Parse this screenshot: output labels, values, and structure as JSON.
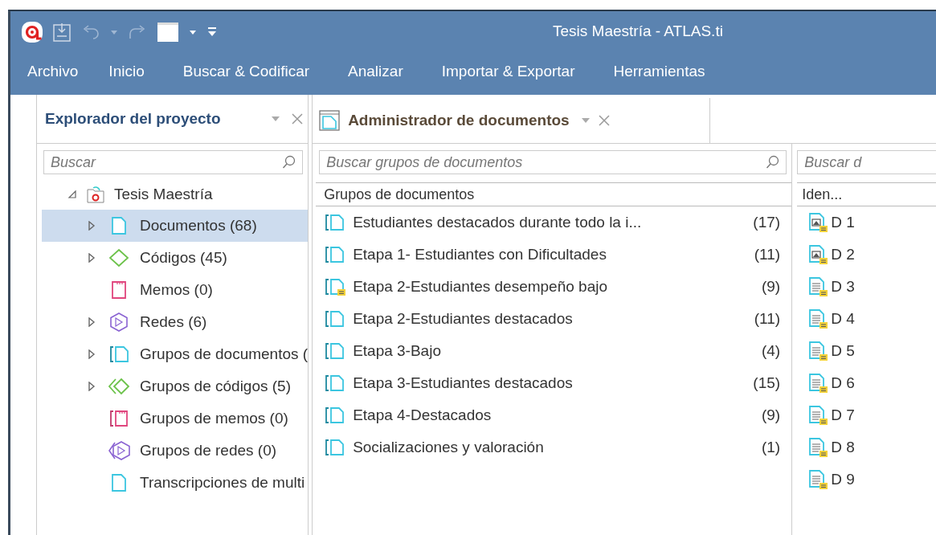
{
  "window": {
    "title": "Tesis Maestría - ATLAS.ti"
  },
  "menu": [
    "Archivo",
    "Inicio",
    "Buscar & Codificar",
    "Analizar",
    "Importar & Exportar",
    "Herramientas"
  ],
  "explorer": {
    "title": "Explorador del proyecto",
    "search": {
      "placeholder": "Buscar"
    },
    "tree": [
      {
        "label": "Tesis Maestría",
        "kind": "project",
        "expanded": true,
        "selected": false,
        "children": [
          {
            "label": "Documentos (68)",
            "kind": "document",
            "expanded": false,
            "selected": true
          },
          {
            "label": "Códigos (45)",
            "kind": "code",
            "expanded": false,
            "selected": false
          },
          {
            "label": "Memos (0)",
            "kind": "memo",
            "selected": false
          },
          {
            "label": "Redes (6)",
            "kind": "network",
            "expanded": false,
            "selected": false
          },
          {
            "label": "Grupos de documentos (",
            "kind": "docgroup",
            "expanded": false,
            "selected": false
          },
          {
            "label": "Grupos de códigos (5)",
            "kind": "codegroup",
            "expanded": false,
            "selected": false
          },
          {
            "label": "Grupos de memos (0)",
            "kind": "memogroup",
            "selected": false
          },
          {
            "label": "Grupos de redes (0)",
            "kind": "networkgroup",
            "selected": false
          },
          {
            "label": "Transcripciones de multi",
            "kind": "document",
            "selected": false
          }
        ]
      }
    ]
  },
  "manager": {
    "tab": "Administrador de documentos",
    "search": {
      "placeholder": "Buscar grupos de documentos"
    },
    "column": "Grupos de documentos",
    "rows": [
      {
        "name": "Estudiantes destacados durante todo la i...",
        "count": "(17)",
        "commented": false
      },
      {
        "name": "Etapa 1- Estudiantes con Dificultades",
        "count": "(11)",
        "commented": false
      },
      {
        "name": "Etapa 2-Estudiantes desempeño bajo",
        "count": "(9)",
        "commented": true
      },
      {
        "name": "Etapa 2-Estudiantes destacados",
        "count": "(11)",
        "commented": false
      },
      {
        "name": "Etapa 3-Bajo",
        "count": "(4)",
        "commented": false
      },
      {
        "name": "Etapa 3-Estudiantes destacados",
        "count": "(15)",
        "commented": false
      },
      {
        "name": "Etapa 4-Destacados",
        "count": "(9)",
        "commented": false
      },
      {
        "name": "Socializaciones y valoración",
        "count": "(1)",
        "commented": false
      }
    ]
  },
  "documents": {
    "search": {
      "placeholder": "Buscar d"
    },
    "column": "Iden...",
    "rows": [
      {
        "id": "D 1",
        "kind": "image",
        "commented": true
      },
      {
        "id": "D 2",
        "kind": "image",
        "commented": true
      },
      {
        "id": "D 3",
        "kind": "text",
        "commented": true
      },
      {
        "id": "D 4",
        "kind": "text",
        "commented": true
      },
      {
        "id": "D 5",
        "kind": "text",
        "commented": true
      },
      {
        "id": "D 6",
        "kind": "text",
        "commented": true
      },
      {
        "id": "D 7",
        "kind": "text",
        "commented": true
      },
      {
        "id": "D 8",
        "kind": "text",
        "commented": true
      },
      {
        "id": "D 9",
        "kind": "text",
        "commented": true
      }
    ]
  }
}
